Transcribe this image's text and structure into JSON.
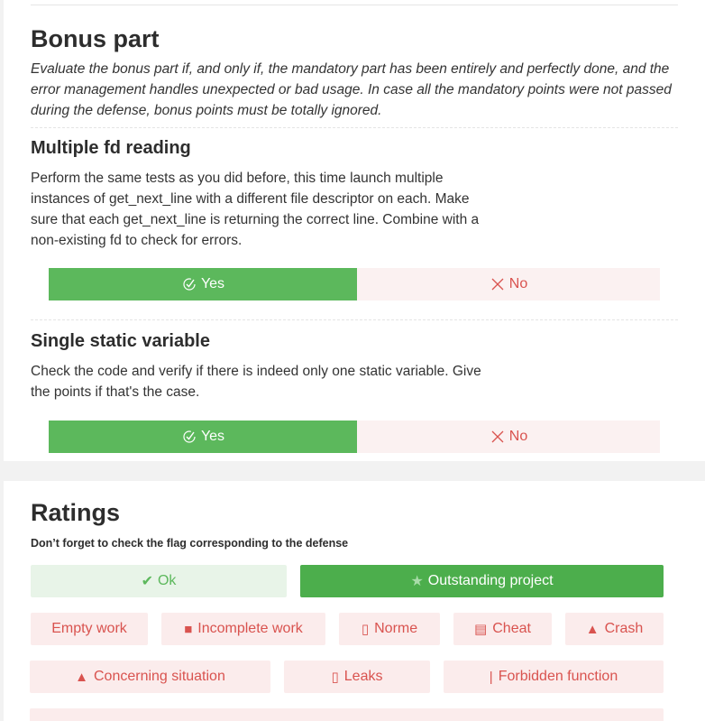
{
  "bonus": {
    "title": "Bonus part",
    "intro": "Evaluate the bonus part if, and only if, the mandatory part has been entirely and perfectly done, and the error management handles unexpected or bad usage. In case all the mandatory points were not passed during the defense, bonus points must be totally ignored.",
    "sections": [
      {
        "title": "Multiple fd reading",
        "description": "Perform the same tests as you did before, this time launch multiple instances of get_next_line with a different file descriptor on each. Make sure that each get_next_line is returning the correct line. Combine with a non-existing fd to check for errors.",
        "yes_label": "Yes",
        "no_label": "No",
        "selected": "Yes"
      },
      {
        "title": "Single static variable",
        "description": "Check the code and verify if there is indeed only one static variable. Give the points if that's the case.",
        "yes_label": "Yes",
        "no_label": "No",
        "selected": "Yes"
      }
    ]
  },
  "ratings": {
    "title": "Ratings",
    "note": "Don’t forget to check the flag corresponding to the defense",
    "ok_label": "Ok",
    "outstanding_label": "Outstanding project",
    "empty_label": "Empty work",
    "incomplete_label": "Incomplete work",
    "norme_label": "Norme",
    "cheat_label": "Cheat",
    "crash_label": "Crash",
    "concerning_label": "Concerning situation",
    "leaks_label": "Leaks",
    "forbidden_label": "Forbidden function"
  },
  "colors": {
    "yes_green": "#5cb85c",
    "no_red": "#d9534f",
    "outstanding_green": "#4cae4c"
  }
}
